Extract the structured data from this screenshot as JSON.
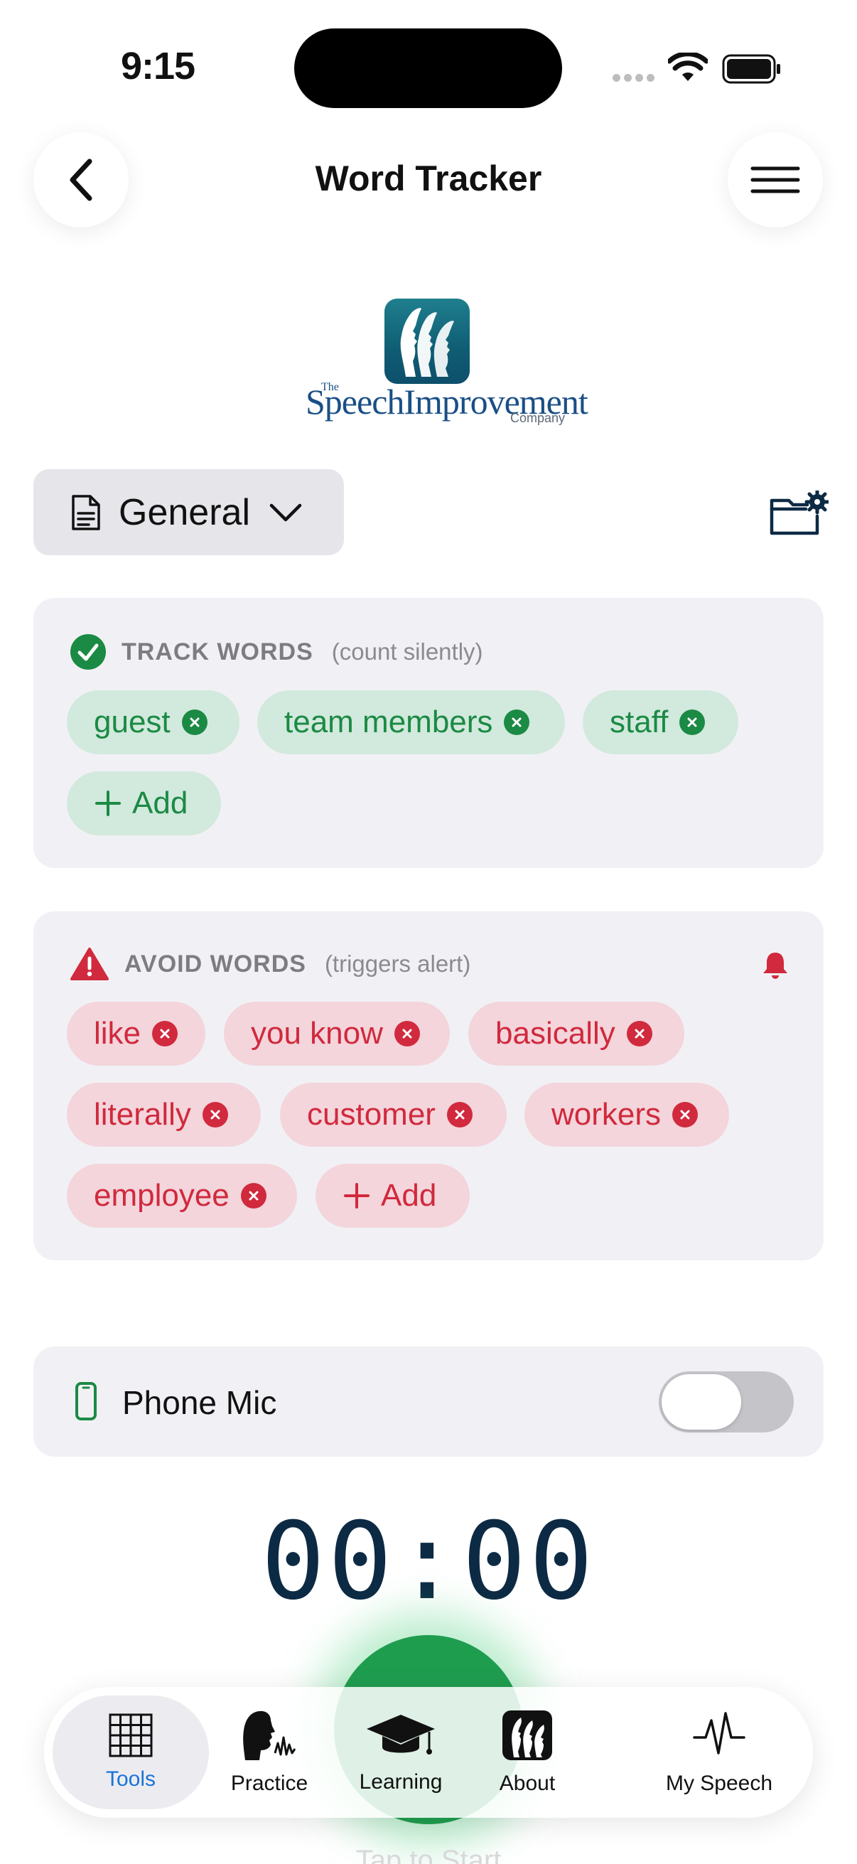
{
  "status_bar": {
    "time": "9:15"
  },
  "header": {
    "title": "Word Tracker"
  },
  "logo": {
    "the": "The",
    "name": "SpeechImprovement",
    "company": "Company"
  },
  "category_picker": {
    "selected": "General"
  },
  "track_words": {
    "title": "TRACK WORDS",
    "subtitle": "(count silently)",
    "words": [
      "guest",
      "team members",
      "staff"
    ],
    "add_label": "Add",
    "color": "#1b8a44"
  },
  "avoid_words": {
    "title": "AVOID WORDS",
    "subtitle": "(triggers alert)",
    "words": [
      "like",
      "you know",
      "basically",
      "literally",
      "customer",
      "workers",
      "employee"
    ],
    "add_label": "Add",
    "color": "#d1293d"
  },
  "mic": {
    "label": "Phone Mic",
    "enabled": false
  },
  "timer": {
    "display": "00:00"
  },
  "hint_text": "Tap to Start",
  "tabs": [
    {
      "label": "Tools",
      "icon": "grid-icon",
      "active": true
    },
    {
      "label": "Practice",
      "icon": "speaking-head-icon",
      "active": false
    },
    {
      "label": "Learning",
      "icon": "graduation-cap-icon",
      "active": false
    },
    {
      "label": "About",
      "icon": "speech-logo-icon",
      "active": false
    },
    {
      "label": "My Speech",
      "icon": "waveform-icon",
      "active": false
    }
  ]
}
